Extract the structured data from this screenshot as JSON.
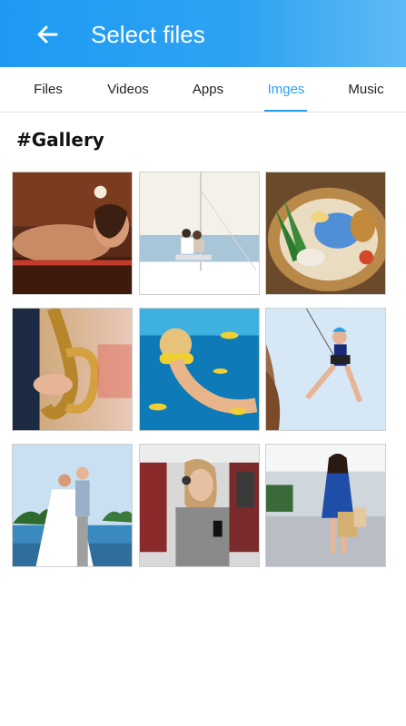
{
  "header": {
    "title": "Select files",
    "background": "#2aa0f0"
  },
  "tabs": [
    {
      "label": "Files",
      "active": false
    },
    {
      "label": "Videos",
      "active": false
    },
    {
      "label": "Apps",
      "active": false
    },
    {
      "label": "Imges",
      "active": true
    },
    {
      "label": "Music",
      "active": false
    }
  ],
  "accent_color": "#2aa0f0",
  "gallery": {
    "title": "#Gallery",
    "images": [
      {
        "subject": "spa massage woman"
      },
      {
        "subject": "couple on sailboat"
      },
      {
        "subject": "asian food platter"
      },
      {
        "subject": "saxophone player"
      },
      {
        "subject": "snorkeling underwater"
      },
      {
        "subject": "woman rock climbing"
      },
      {
        "subject": "wedding couple beach"
      },
      {
        "subject": "woman on airplane with phone"
      },
      {
        "subject": "woman shopping bags mall"
      }
    ]
  }
}
